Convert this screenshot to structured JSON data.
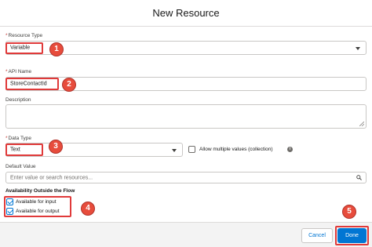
{
  "modal": {
    "title": "New Resource"
  },
  "resource_type": {
    "label": "Resource Type",
    "value": "Variable"
  },
  "api_name": {
    "label": "API Name",
    "value": "StoreContactId"
  },
  "description": {
    "label": "Description",
    "value": ""
  },
  "data_type": {
    "label": "Data Type",
    "value": "Text",
    "allow_multiple_label": "Allow multiple values (collection)"
  },
  "default_value": {
    "label": "Default Value",
    "placeholder": "Enter value or search resources..."
  },
  "availability": {
    "title": "Availability Outside the Flow",
    "input_label": "Available for input",
    "input_checked": true,
    "output_label": "Available for output",
    "output_checked": true
  },
  "annotations": {
    "n1": "1",
    "n2": "2",
    "n3": "3",
    "n4": "4",
    "n5": "5"
  },
  "footer": {
    "cancel_label": "Cancel",
    "done_label": "Done"
  },
  "colors": {
    "annotation_red": "#e03a3a",
    "brand_blue": "#0176d3"
  }
}
